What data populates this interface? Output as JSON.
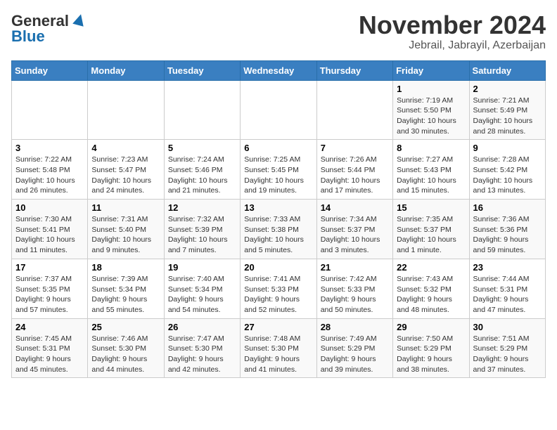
{
  "header": {
    "logo_general": "General",
    "logo_blue": "Blue",
    "main_title": "November 2024",
    "subtitle": "Jebrail, Jabrayil, Azerbaijan"
  },
  "columns": [
    "Sunday",
    "Monday",
    "Tuesday",
    "Wednesday",
    "Thursday",
    "Friday",
    "Saturday"
  ],
  "weeks": [
    [
      {
        "day": "",
        "info": ""
      },
      {
        "day": "",
        "info": ""
      },
      {
        "day": "",
        "info": ""
      },
      {
        "day": "",
        "info": ""
      },
      {
        "day": "",
        "info": ""
      },
      {
        "day": "1",
        "info": "Sunrise: 7:19 AM\nSunset: 5:50 PM\nDaylight: 10 hours and 30 minutes."
      },
      {
        "day": "2",
        "info": "Sunrise: 7:21 AM\nSunset: 5:49 PM\nDaylight: 10 hours and 28 minutes."
      }
    ],
    [
      {
        "day": "3",
        "info": "Sunrise: 7:22 AM\nSunset: 5:48 PM\nDaylight: 10 hours and 26 minutes."
      },
      {
        "day": "4",
        "info": "Sunrise: 7:23 AM\nSunset: 5:47 PM\nDaylight: 10 hours and 24 minutes."
      },
      {
        "day": "5",
        "info": "Sunrise: 7:24 AM\nSunset: 5:46 PM\nDaylight: 10 hours and 21 minutes."
      },
      {
        "day": "6",
        "info": "Sunrise: 7:25 AM\nSunset: 5:45 PM\nDaylight: 10 hours and 19 minutes."
      },
      {
        "day": "7",
        "info": "Sunrise: 7:26 AM\nSunset: 5:44 PM\nDaylight: 10 hours and 17 minutes."
      },
      {
        "day": "8",
        "info": "Sunrise: 7:27 AM\nSunset: 5:43 PM\nDaylight: 10 hours and 15 minutes."
      },
      {
        "day": "9",
        "info": "Sunrise: 7:28 AM\nSunset: 5:42 PM\nDaylight: 10 hours and 13 minutes."
      }
    ],
    [
      {
        "day": "10",
        "info": "Sunrise: 7:30 AM\nSunset: 5:41 PM\nDaylight: 10 hours and 11 minutes."
      },
      {
        "day": "11",
        "info": "Sunrise: 7:31 AM\nSunset: 5:40 PM\nDaylight: 10 hours and 9 minutes."
      },
      {
        "day": "12",
        "info": "Sunrise: 7:32 AM\nSunset: 5:39 PM\nDaylight: 10 hours and 7 minutes."
      },
      {
        "day": "13",
        "info": "Sunrise: 7:33 AM\nSunset: 5:38 PM\nDaylight: 10 hours and 5 minutes."
      },
      {
        "day": "14",
        "info": "Sunrise: 7:34 AM\nSunset: 5:37 PM\nDaylight: 10 hours and 3 minutes."
      },
      {
        "day": "15",
        "info": "Sunrise: 7:35 AM\nSunset: 5:37 PM\nDaylight: 10 hours and 1 minute."
      },
      {
        "day": "16",
        "info": "Sunrise: 7:36 AM\nSunset: 5:36 PM\nDaylight: 9 hours and 59 minutes."
      }
    ],
    [
      {
        "day": "17",
        "info": "Sunrise: 7:37 AM\nSunset: 5:35 PM\nDaylight: 9 hours and 57 minutes."
      },
      {
        "day": "18",
        "info": "Sunrise: 7:39 AM\nSunset: 5:34 PM\nDaylight: 9 hours and 55 minutes."
      },
      {
        "day": "19",
        "info": "Sunrise: 7:40 AM\nSunset: 5:34 PM\nDaylight: 9 hours and 54 minutes."
      },
      {
        "day": "20",
        "info": "Sunrise: 7:41 AM\nSunset: 5:33 PM\nDaylight: 9 hours and 52 minutes."
      },
      {
        "day": "21",
        "info": "Sunrise: 7:42 AM\nSunset: 5:33 PM\nDaylight: 9 hours and 50 minutes."
      },
      {
        "day": "22",
        "info": "Sunrise: 7:43 AM\nSunset: 5:32 PM\nDaylight: 9 hours and 48 minutes."
      },
      {
        "day": "23",
        "info": "Sunrise: 7:44 AM\nSunset: 5:31 PM\nDaylight: 9 hours and 47 minutes."
      }
    ],
    [
      {
        "day": "24",
        "info": "Sunrise: 7:45 AM\nSunset: 5:31 PM\nDaylight: 9 hours and 45 minutes."
      },
      {
        "day": "25",
        "info": "Sunrise: 7:46 AM\nSunset: 5:30 PM\nDaylight: 9 hours and 44 minutes."
      },
      {
        "day": "26",
        "info": "Sunrise: 7:47 AM\nSunset: 5:30 PM\nDaylight: 9 hours and 42 minutes."
      },
      {
        "day": "27",
        "info": "Sunrise: 7:48 AM\nSunset: 5:30 PM\nDaylight: 9 hours and 41 minutes."
      },
      {
        "day": "28",
        "info": "Sunrise: 7:49 AM\nSunset: 5:29 PM\nDaylight: 9 hours and 39 minutes."
      },
      {
        "day": "29",
        "info": "Sunrise: 7:50 AM\nSunset: 5:29 PM\nDaylight: 9 hours and 38 minutes."
      },
      {
        "day": "30",
        "info": "Sunrise: 7:51 AM\nSunset: 5:29 PM\nDaylight: 9 hours and 37 minutes."
      }
    ]
  ]
}
